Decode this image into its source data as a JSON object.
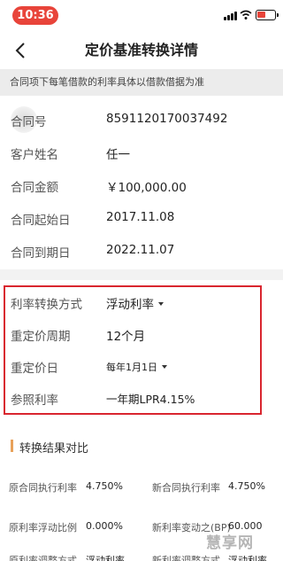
{
  "status_bar": {
    "time": "10:36"
  },
  "nav": {
    "title": "定价基准转换详情"
  },
  "notice": "合同项下每笔借款的利率具体以借款借据为准",
  "info": [
    {
      "label": "合同号",
      "value": "8591120170037492"
    },
    {
      "label": "客户姓名",
      "value": "任一"
    },
    {
      "label": "合同金额",
      "value": "￥100,000.00"
    },
    {
      "label": "合同起始日",
      "value": "2017.11.08"
    },
    {
      "label": "合同到期日",
      "value": "2022.11.07"
    }
  ],
  "conversion": {
    "method": {
      "label": "利率转换方式",
      "value": "浮动利率"
    },
    "period": {
      "label": "重定价周期",
      "value": "12个月"
    },
    "reprice_day": {
      "label": "重定价日",
      "value": "每年1月1日"
    },
    "ref_rate": {
      "label": "参照利率",
      "value": "一年期LPR4.15%"
    }
  },
  "result": {
    "title": "转换结果对比",
    "rows": [
      {
        "l1": "原合同执行利率",
        "v1": "4.750%",
        "l2": "新合同执行利率",
        "v2": "4.750%"
      },
      {
        "l1": "原利率浮动比例",
        "v1": "0.000%",
        "l2": "新利率变动之(BP)",
        "v2": "60.000"
      },
      {
        "l1": "原利率调整方式",
        "v1": "浮动利率",
        "l2": "新利率调整方式",
        "v2": "浮动利率"
      }
    ]
  },
  "watermark": "慧享网"
}
